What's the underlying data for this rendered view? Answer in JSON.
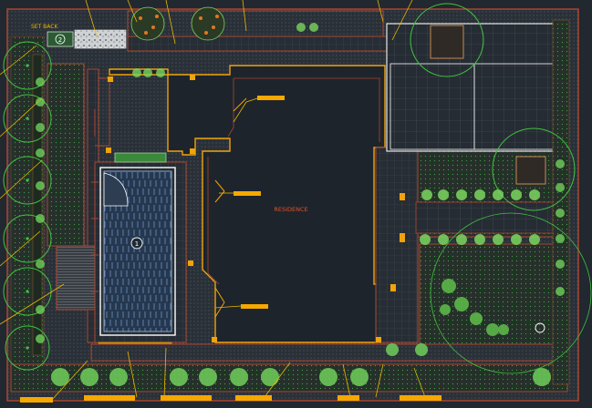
{
  "drawing": {
    "title_label": "RESIDENCE",
    "setback_label": "SET BACK",
    "pool_marker": "1",
    "setback_marker": "2"
  },
  "colors": {
    "background": "#212830",
    "wall": "#f0a30a",
    "boundary": "#a9462f",
    "hatch": "#4a4f55",
    "planting": "#2fb52f",
    "tree_canopy": "#7bd65f",
    "pool_water": "#3d5f86",
    "leader": "#e8b800",
    "callout": "#f5a800",
    "grid": "#5a6068"
  },
  "callouts": [
    {
      "id": "callout-residence-1",
      "text": ""
    },
    {
      "id": "callout-residence-2",
      "text": ""
    },
    {
      "id": "callout-residence-3",
      "text": ""
    },
    {
      "id": "callout-bottom-1",
      "text": ""
    },
    {
      "id": "callout-bottom-2",
      "text": ""
    },
    {
      "id": "callout-bottom-3",
      "text": ""
    },
    {
      "id": "callout-bottom-4",
      "text": ""
    },
    {
      "id": "callout-bottom-5",
      "text": ""
    },
    {
      "id": "callout-bottom-6",
      "text": ""
    }
  ]
}
